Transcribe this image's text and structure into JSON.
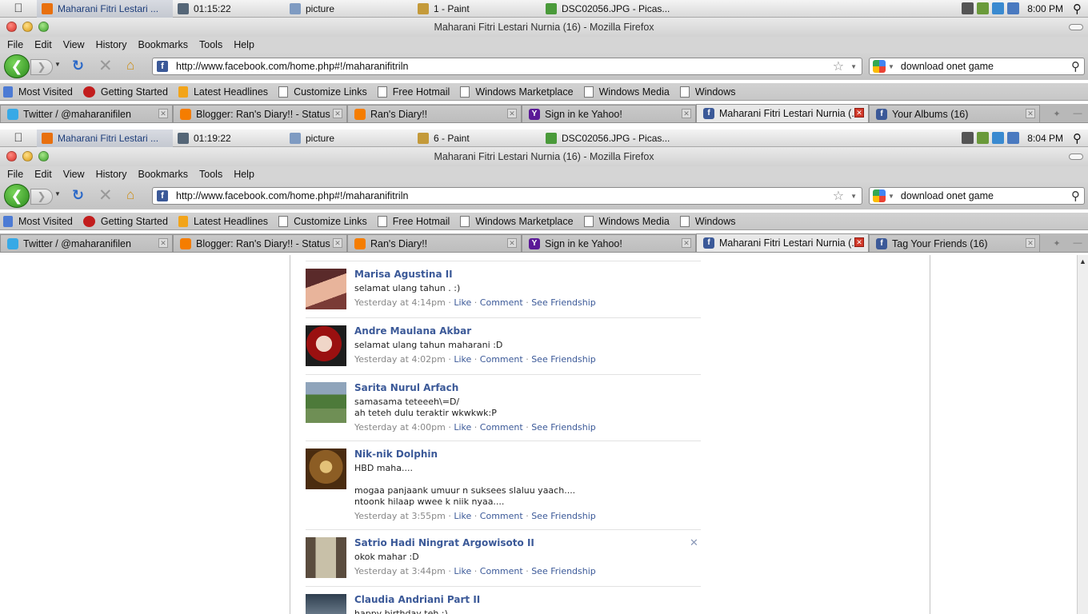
{
  "menubar_top": {
    "tasks": [
      {
        "label": "Maharani Fitri Lestari ...",
        "icon": "firefox-icon",
        "color": "#e8700f",
        "active": true
      },
      {
        "label": "01:15:22",
        "icon": "timer-icon",
        "color": "#556677"
      },
      {
        "label": "picture",
        "icon": "folder-picture-icon",
        "color": "#7f9bc2"
      },
      {
        "label": "1 - Paint",
        "icon": "paint-icon",
        "color": "#c49a3a"
      },
      {
        "label": "DSC02056.JPG - Picas...",
        "icon": "picasa-icon",
        "color": "#4a9a3a"
      }
    ],
    "clock": "8:00 PM"
  },
  "menubar_bottom": {
    "tasks": [
      {
        "label": "Maharani Fitri Lestari ...",
        "icon": "firefox-icon",
        "color": "#e8700f",
        "active": true
      },
      {
        "label": "01:19:22",
        "icon": "timer-icon",
        "color": "#556677"
      },
      {
        "label": "picture",
        "icon": "folder-picture-icon",
        "color": "#7f9bc2"
      },
      {
        "label": "6 - Paint",
        "icon": "paint-icon",
        "color": "#c49a3a"
      },
      {
        "label": "DSC02056.JPG - Picas...",
        "icon": "picasa-icon",
        "color": "#4a9a3a"
      }
    ],
    "clock": "8:04 PM"
  },
  "window": {
    "title": "Maharani Fitri Lestari Nurnia (16) - Mozilla Firefox",
    "menus": [
      "File",
      "Edit",
      "View",
      "History",
      "Bookmarks",
      "Tools",
      "Help"
    ],
    "url": "http://www.facebook.com/home.php#!/maharanifitriln",
    "search_value": "download onet game"
  },
  "bookmarks": [
    {
      "label": "Most Visited",
      "icon": "smart-folder-icon",
      "kind": "smart"
    },
    {
      "label": "Getting Started",
      "icon": "firefox-logo-icon",
      "kind": "fox"
    },
    {
      "label": "Latest Headlines",
      "icon": "rss-icon",
      "kind": "rss"
    },
    {
      "label": "Customize Links",
      "icon": "page-icon",
      "kind": "page"
    },
    {
      "label": "Free Hotmail",
      "icon": "page-icon",
      "kind": "page"
    },
    {
      "label": "Windows Marketplace",
      "icon": "page-icon",
      "kind": "page"
    },
    {
      "label": "Windows Media",
      "icon": "page-icon",
      "kind": "page"
    },
    {
      "label": "Windows",
      "icon": "page-icon",
      "kind": "page"
    }
  ],
  "tabs_top": [
    {
      "label": "Twitter / @maharanifilen",
      "fav": "tw"
    },
    {
      "label": "Blogger: Ran's Diary!! - Status ...",
      "fav": "bl"
    },
    {
      "label": "Ran's Diary!!",
      "fav": "bl"
    },
    {
      "label": "Sign in ke Yahoo!",
      "fav": "yh"
    },
    {
      "label": "Maharani Fitri Lestari Nurnia (...",
      "fav": "fb",
      "active": true
    },
    {
      "label": "Your Albums (16)",
      "fav": "fb"
    }
  ],
  "tabs_bottom": [
    {
      "label": "Twitter / @maharanifilen",
      "fav": "tw"
    },
    {
      "label": "Blogger: Ran's Diary!! - Status ...",
      "fav": "bl"
    },
    {
      "label": "Ran's Diary!!",
      "fav": "bl"
    },
    {
      "label": "Sign in ke Yahoo!",
      "fav": "yh"
    },
    {
      "label": "Maharani Fitri Lestari Nurnia (...",
      "fav": "fb",
      "active": true
    },
    {
      "label": "Tag Your Friends (16)",
      "fav": "fb"
    }
  ],
  "posts": [
    {
      "name": "Marisa Agustina II",
      "message": "selamat ulang tahun . :)",
      "time": "Yesterday at 4:14pm",
      "avatar": "av1"
    },
    {
      "name": "Andre Maulana Akbar",
      "message": "selamat ulang tahun maharani :D",
      "time": "Yesterday at 4:02pm",
      "avatar": "av2"
    },
    {
      "name": "Sarita Nurul Arfach",
      "message": "samasama teteeeh\\=D/\nah teteh dulu teraktir wkwkwk:P",
      "time": "Yesterday at 4:00pm",
      "avatar": "av3"
    },
    {
      "name": "Nik-nik Dolphin",
      "message": "HBD maha....\n\nmogaa panjaank umuur n suksees slaluu yaach....\nntoonk hilaap wwee k niik nyaa....",
      "time": "Yesterday at 3:55pm",
      "avatar": "av4"
    },
    {
      "name": "Satrio Hadi Ningrat Argowisoto II",
      "message": "okok mahar :D",
      "time": "Yesterday at 3:44pm",
      "avatar": "av5"
    },
    {
      "name": "Claudia Andriani Part II",
      "message": "happy birthday teh :)",
      "time": "",
      "avatar": "av6"
    }
  ],
  "post_actions": {
    "like": "Like",
    "comment": "Comment",
    "see_friendship": "See Friendship",
    "dot": " · "
  }
}
